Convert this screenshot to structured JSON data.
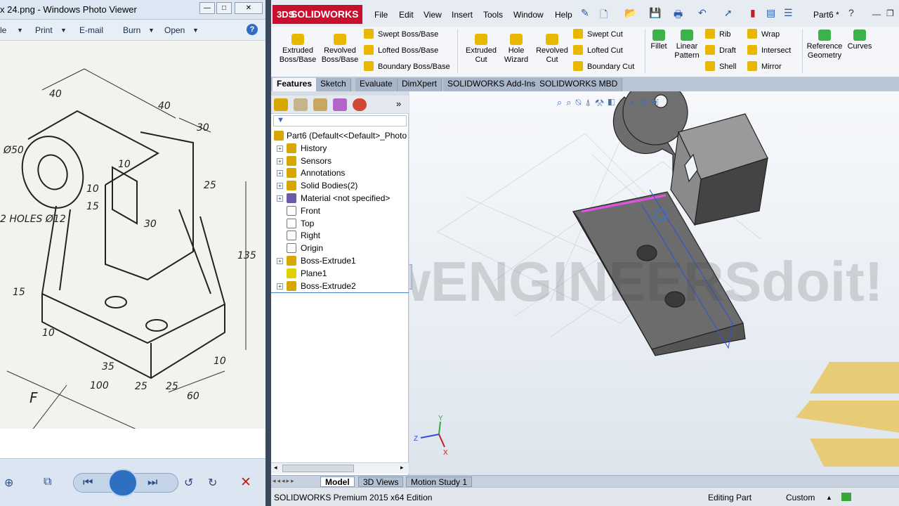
{
  "photo_viewer": {
    "title": "x 24.png - Windows Photo Viewer",
    "title_buttons": [
      "—",
      "□",
      "✕"
    ],
    "menu": [
      "le",
      "Print",
      "E-mail",
      "Burn",
      "Open"
    ],
    "help": "?",
    "drawing_labels": [
      "40",
      "40",
      "30",
      "Ø50",
      "10",
      "25",
      "15",
      "10",
      "30",
      "2 HOLES Ø12",
      "135",
      "15",
      "10",
      "35",
      "100",
      "25",
      "25",
      "60",
      "10",
      "F"
    ]
  },
  "solidworks": {
    "logo": "SOLIDWORKS",
    "logo_mark": "3DS",
    "menu": [
      "File",
      "Edit",
      "View",
      "Insert",
      "Tools",
      "Window",
      "Help"
    ],
    "doc_name": "Part6 *",
    "ribbon": {
      "big": [
        {
          "label1": "Extruded",
          "label2": "Boss/Base",
          "color": "#e8b800"
        },
        {
          "label1": "Revolved",
          "label2": "Boss/Base",
          "color": "#e8b800"
        },
        {
          "label1": "Extruded",
          "label2": "Cut",
          "color": "#e8b800"
        },
        {
          "label1": "Hole",
          "label2": "Wizard",
          "color": "#e8b800"
        },
        {
          "label1": "Revolved",
          "label2": "Cut",
          "color": "#e8b800"
        },
        {
          "label1": "Fillet",
          "label2": "",
          "color": "#3cb34a"
        },
        {
          "label1": "Linear",
          "label2": "Pattern",
          "color": "#3cb34a"
        },
        {
          "label1": "Reference",
          "label2": "Geometry",
          "color": "#3cb34a"
        },
        {
          "label1": "Curves",
          "label2": "",
          "color": "#3cb34a"
        }
      ],
      "small": [
        "Swept Boss/Base",
        "Lofted Boss/Base",
        "Boundary Boss/Base",
        "Swept Cut",
        "Lofted Cut",
        "Boundary Cut",
        "Rib",
        "Draft",
        "Shell",
        "Wrap",
        "Intersect",
        "Mirror"
      ]
    },
    "tabs": [
      "Features",
      "Sketch",
      "Evaluate",
      "DimXpert",
      "SOLIDWORKS Add-Ins",
      "SOLIDWORKS MBD"
    ],
    "tree": [
      {
        "label": "Part6  (Default<<Default>_Photo",
        "icon": "part"
      },
      {
        "label": "History",
        "icon": "history"
      },
      {
        "label": "Sensors",
        "icon": "sensors"
      },
      {
        "label": "Annotations",
        "icon": "annotations"
      },
      {
        "label": "Solid Bodies(2)",
        "icon": "solid-bodies"
      },
      {
        "label": "Material <not specified>",
        "icon": "material"
      },
      {
        "label": "Front",
        "icon": "plane"
      },
      {
        "label": "Top",
        "icon": "plane"
      },
      {
        "label": "Right",
        "icon": "plane"
      },
      {
        "label": "Origin",
        "icon": "origin"
      },
      {
        "label": "Boss-Extrude1",
        "icon": "feature"
      },
      {
        "label": "Plane1",
        "icon": "plane-active"
      },
      {
        "label": "Boss-Extrude2",
        "icon": "feature"
      }
    ],
    "triad": {
      "y": "Y",
      "z": "Z",
      "x": "X"
    },
    "watermark": "howENGINEERSdoit!",
    "bottom_tabs": [
      "Model",
      "3D Views",
      "Motion Study 1"
    ],
    "status": {
      "edition": "SOLIDWORKS Premium 2015 x64 Edition",
      "mode": "Editing Part",
      "units": "Custom"
    }
  }
}
